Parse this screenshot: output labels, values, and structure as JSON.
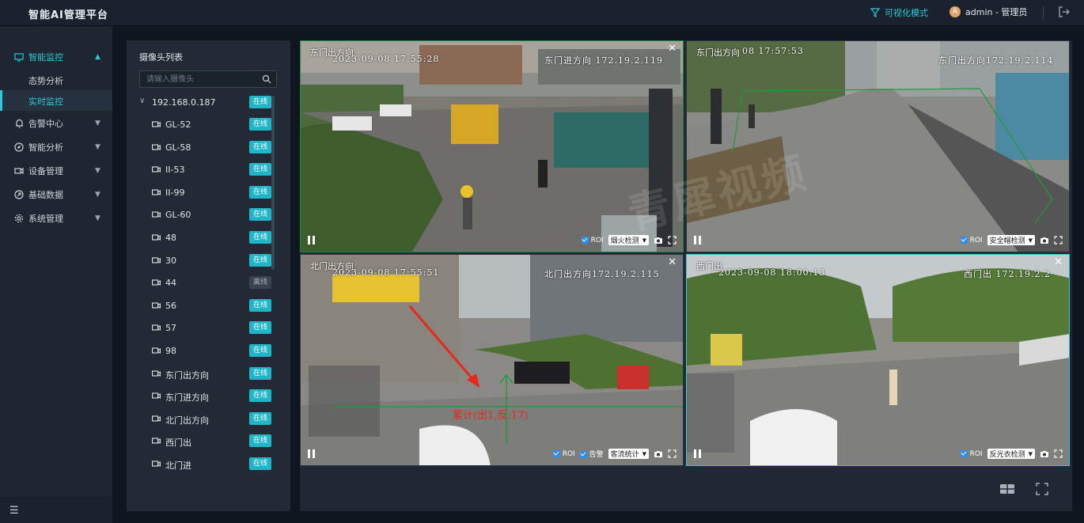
{
  "app": {
    "title": "智能AI管理平台"
  },
  "header": {
    "viz_mode": "可视化模式",
    "avatar_letter": "A",
    "user": "admin - 管理员"
  },
  "sidebar": {
    "items": [
      {
        "label": "智能监控",
        "icon": "monitor-icon",
        "expanded": true
      },
      {
        "label": "告警中心",
        "icon": "bell-icon"
      },
      {
        "label": "智能分析",
        "icon": "compass-icon"
      },
      {
        "label": "设备管理",
        "icon": "video-camera-icon"
      },
      {
        "label": "基础数据",
        "icon": "database-icon"
      },
      {
        "label": "系统管理",
        "icon": "gear-icon"
      }
    ],
    "subitems": [
      {
        "label": "态势分析"
      },
      {
        "label": "实时监控",
        "selected": true
      }
    ]
  },
  "camera_list": {
    "title": "摄像头列表",
    "search_placeholder": "请输入摄像头",
    "group": {
      "name": "192.168.0.187",
      "status": "在线"
    },
    "cameras": [
      {
        "name": "GL-52",
        "status": "在线"
      },
      {
        "name": "GL-58",
        "status": "在线"
      },
      {
        "name": "II-53",
        "status": "在线"
      },
      {
        "name": "II-99",
        "status": "在线"
      },
      {
        "name": "GL-60",
        "status": "在线"
      },
      {
        "name": "48",
        "status": "在线"
      },
      {
        "name": "30",
        "status": "在线"
      },
      {
        "name": "44",
        "status": "离线"
      },
      {
        "name": "56",
        "status": "在线"
      },
      {
        "name": "57",
        "status": "在线"
      },
      {
        "name": "98",
        "status": "在线"
      },
      {
        "name": "东门出方向",
        "status": "在线"
      },
      {
        "name": "东门进方向",
        "status": "在线"
      },
      {
        "name": "北门出方向",
        "status": "在线"
      },
      {
        "name": "西门出",
        "status": "在线"
      },
      {
        "name": "北门进",
        "status": "在线"
      }
    ]
  },
  "tiles": [
    {
      "osd_title": "东门出方向",
      "osd_time": "2023-09-08 17:55:28",
      "osd_right": "东门进方向 172.19.2.119",
      "roi_label": "ROI",
      "detection": "烟火检测"
    },
    {
      "osd_title": "东门出方向",
      "osd_time": "08 17:57:53",
      "osd_right": "东门出方向172.19.2.114",
      "roi_label": "ROI",
      "detection": "安全帽检测"
    },
    {
      "osd_title": "北门出方向",
      "osd_time": "2023-09-08 17:55:51",
      "osd_right": "北门出方向172.19.2.115",
      "roi_label": "ROI",
      "alarm_label": "告警",
      "detection": "客流统计",
      "count_text": "累计(出1,反:17)"
    },
    {
      "osd_title": "西门出",
      "osd_time": "2023-09-08 18:00:13",
      "osd_right": "西门出 172.19.2.2",
      "roi_label": "ROI",
      "detection": "反光衣检测"
    }
  ],
  "watermark": "青犀视频",
  "colors": {
    "accent": "#2ec8d8",
    "online": "#1fb6c9",
    "roi_green": "#1c8a3a",
    "arrow_red": "#e8281c"
  }
}
